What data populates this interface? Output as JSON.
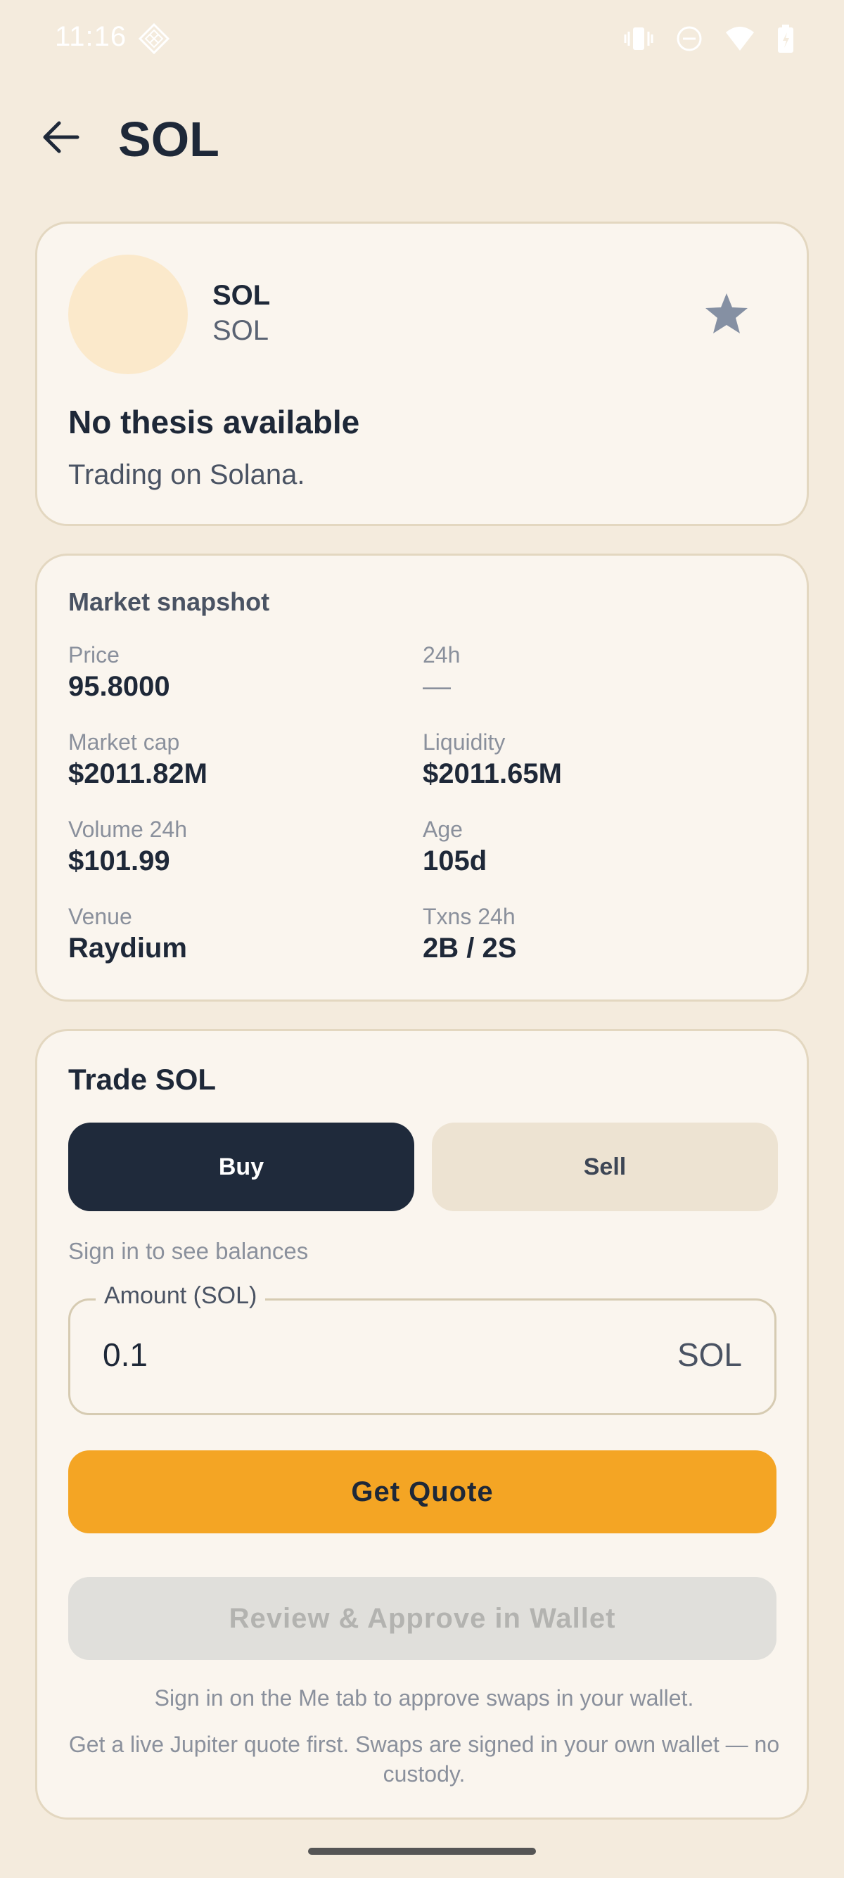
{
  "status_bar": {
    "time": "11:16",
    "icons": [
      "diamond-icon",
      "vibrate-icon",
      "dnd-icon",
      "wifi-icon",
      "battery-icon"
    ]
  },
  "header": {
    "title": "SOL"
  },
  "token": {
    "name": "SOL",
    "symbol": "SOL",
    "thesis_title": "No thesis available",
    "thesis_body": "Trading on Solana."
  },
  "market": {
    "title": "Market snapshot",
    "stats": [
      {
        "label": "Price",
        "value": "95.8000"
      },
      {
        "label": "24h",
        "value": "—"
      },
      {
        "label": "Market cap",
        "value": "$2011.82M"
      },
      {
        "label": "Liquidity",
        "value": "$2011.65M"
      },
      {
        "label": "Volume 24h",
        "value": "$101.99"
      },
      {
        "label": "Age",
        "value": "105d"
      },
      {
        "label": "Venue",
        "value": "Raydium"
      },
      {
        "label": "Txns 24h",
        "value": "2B / 2S"
      }
    ]
  },
  "trade": {
    "title": "Trade SOL",
    "buy_label": "Buy",
    "sell_label": "Sell",
    "balance_hint": "Sign in to see balances",
    "amount_label": "Amount (SOL)",
    "amount_value": "0.1",
    "amount_suffix": "SOL",
    "quote_label": "Get Quote",
    "review_label": "Review & Approve in Wallet",
    "note_sign_in": "Sign in on the Me tab to approve swaps in your wallet.",
    "note_quote": "Get a live Jupiter quote first. Swaps are signed in your own wallet — no custody."
  },
  "colors": {
    "background": "#f4ebdd",
    "card": "#faf5ee",
    "primary_dark": "#1f2a3b",
    "accent": "#f4a524",
    "star": "#8590a3"
  }
}
